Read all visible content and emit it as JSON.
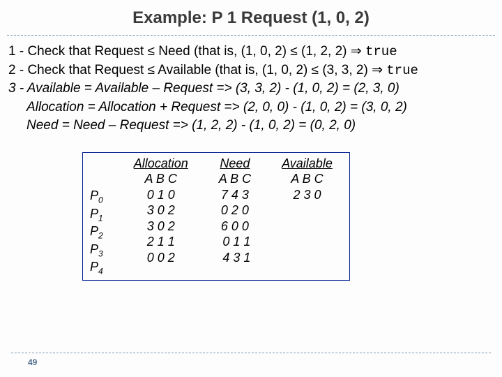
{
  "title": "Example:  P 1 Request (1, 0, 2)",
  "lines": {
    "l1a": "1 - Check that Request ≤ Need (that is, (1, 0, 2) ≤ (1, 2, 2) ⇒  ",
    "l1b": "true",
    "l2a": "2 - Check that Request ≤ Available (that is, (1, 0, 2) ≤ (3, 3, 2) ⇒ ",
    "l2b": "true",
    "l3": "3 -  Available = Available  – Request => (3, 3, 2) - (1, 0, 2) = (2, 3, 0)",
    "l4": "Allocation = Allocation  + Request => (2, 0, 0) - (1, 0, 2) = (3, 0, 2)",
    "l5": "Need = Need  – Request => (1, 2, 2) - (1, 0, 2) = (0, 2, 0)"
  },
  "labels": {
    "p0": "P",
    "s0": "0",
    "p1": "P",
    "s1": "1",
    "p2": "P",
    "s2": "2",
    "p3": "P",
    "s3": "3",
    "p4": "P",
    "s4": "4"
  },
  "alloc": {
    "h": "Allocation",
    "abc": "A B C",
    "r0": "0 1 0",
    "r1": "3 0 2",
    "r2": "3 0 2",
    "r3": "2 1 1",
    "r4": "0 0 2"
  },
  "need": {
    "h": "Need",
    "abc": "A B C",
    "r0": "7 4 3",
    "r1": "0 2 0",
    "r2": "6 0 0",
    "r3": " 0 1 1",
    "r4": " 4 3 1"
  },
  "avail": {
    "h": "Available",
    "abc": "A B C",
    "r0": "2 3 0"
  },
  "page": "49"
}
